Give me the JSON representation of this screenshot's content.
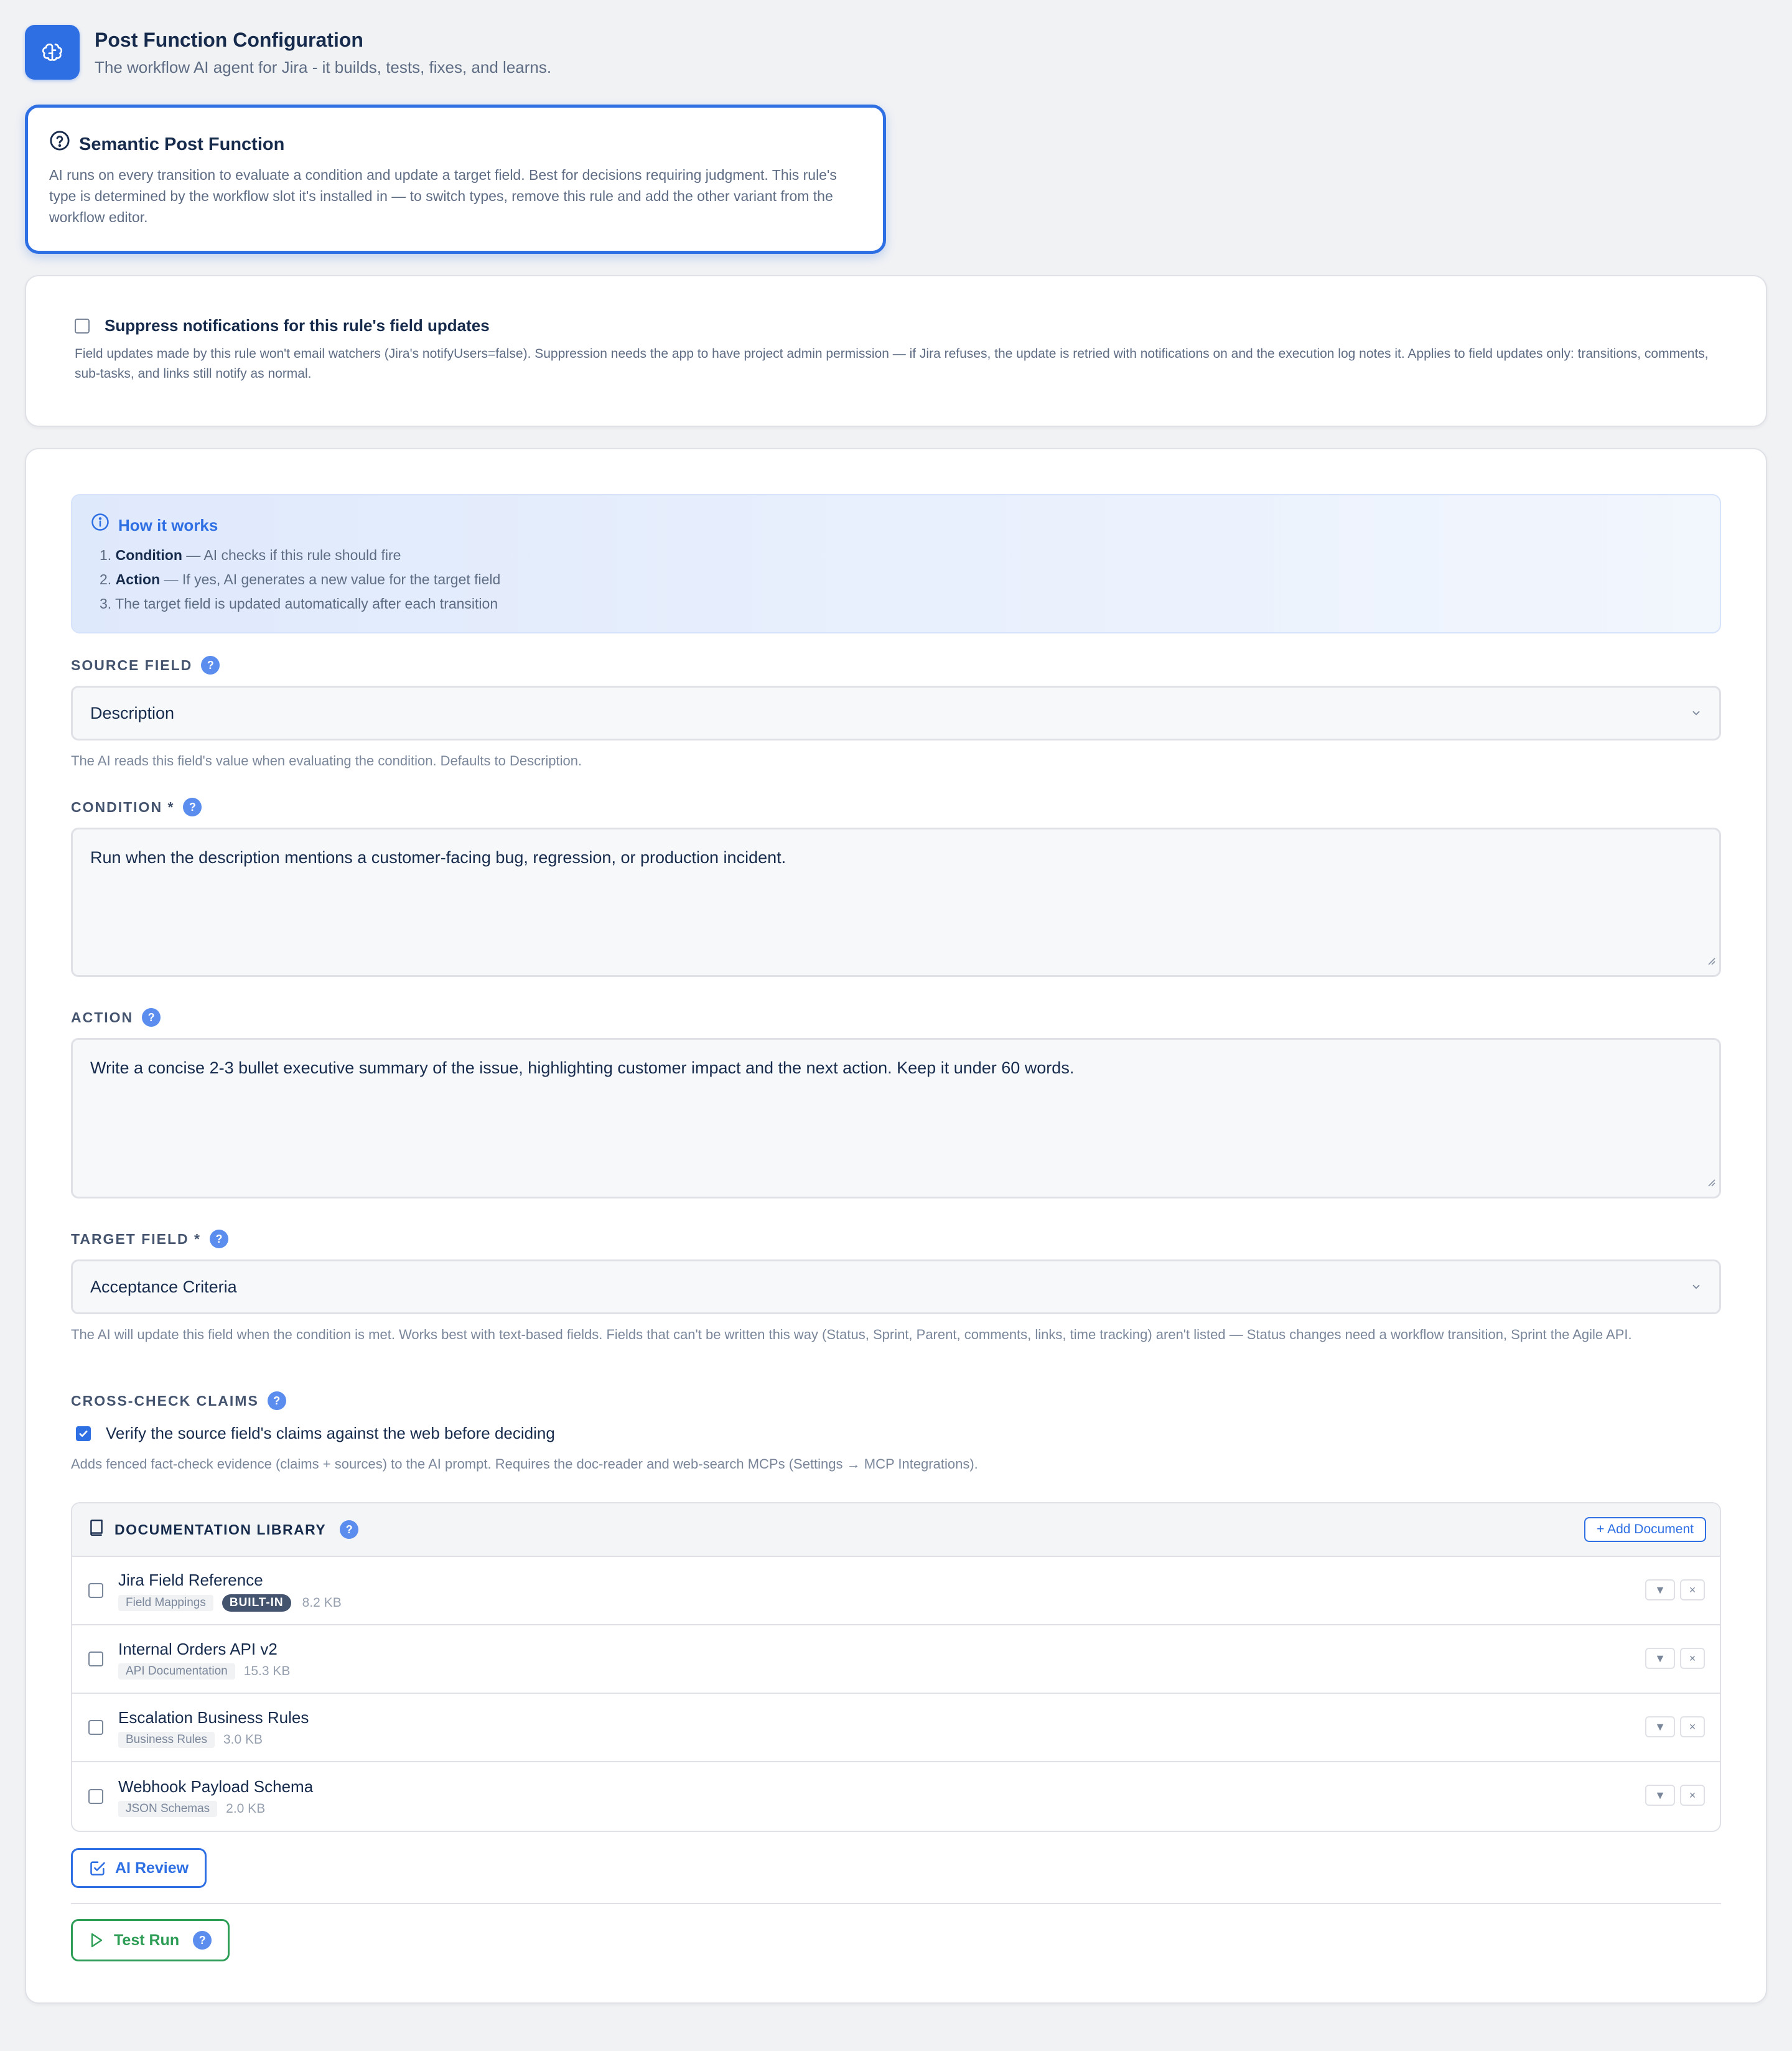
{
  "header": {
    "title": "Post Function Configuration",
    "subtitle": "The workflow AI agent for Jira - it builds, tests, fixes, and learns.",
    "logo_icon": "brain-icon"
  },
  "type_card": {
    "title": "Semantic Post Function",
    "description": "AI runs on every transition to evaluate a condition and update a target field. Best for decisions requiring judgment. This rule's type is determined by the workflow slot it's installed in — to switch types, remove this rule and add the other variant from the workflow editor."
  },
  "notifications": {
    "label": "Suppress notifications for this rule's field updates",
    "checked": false,
    "description": "Field updates made by this rule won't email watchers (Jira's notifyUsers=false). Suppression needs the app to have project admin permission — if Jira refuses, the update is retried with notifications on and the execution log notes it. Applies to field updates only: transitions, comments, sub-tasks, and links still notify as normal."
  },
  "how_it_works": {
    "title": "How it works",
    "steps": [
      {
        "num": "1.",
        "bold": "Condition",
        "text": " — AI checks if this rule should fire"
      },
      {
        "num": "2.",
        "bold": "Action",
        "text": " — If yes, AI generates a new value for the target field"
      },
      {
        "num": "3.",
        "bold": "",
        "text": "The target field is updated automatically after each transition"
      }
    ]
  },
  "source_field": {
    "label": "SOURCE FIELD",
    "value": "Description",
    "hint": "The AI reads this field's value when evaluating the condition. Defaults to Description."
  },
  "condition": {
    "label": "CONDITION *",
    "value": "Run when the description mentions a customer-facing bug, regression, or production incident."
  },
  "action": {
    "label": "ACTION",
    "value": "Write a concise 2-3 bullet executive summary of the issue, highlighting customer impact and the next action. Keep it under 60 words."
  },
  "target_field": {
    "label": "TARGET FIELD *",
    "value": "Acceptance Criteria",
    "hint": "The AI will update this field when the condition is met. Works best with text-based fields. Fields that can't be written this way (Status, Sprint, Parent, comments, links, time tracking) aren't listed — Status changes need a workflow transition, Sprint the Agile API."
  },
  "cross_check": {
    "label": "CROSS-CHECK CLAIMS",
    "checkbox_label": "Verify the source field's claims against the web before deciding",
    "checked": true,
    "hint": "Adds fenced fact-check evidence (claims + sources) to the AI prompt. Requires the doc-reader and web-search MCPs (Settings → MCP Integrations)."
  },
  "doc_library": {
    "title": "DOCUMENTATION LIBRARY",
    "add_label": "+ Add Document",
    "docs": [
      {
        "name": "Jira Field Reference",
        "tag": "Field Mappings",
        "badge": "BUILT-IN",
        "size": "8.2 KB"
      },
      {
        "name": "Internal Orders API v2",
        "tag": "API Documentation",
        "badge": "",
        "size": "15.3 KB"
      },
      {
        "name": "Escalation Business Rules",
        "tag": "Business Rules",
        "badge": "",
        "size": "3.0 KB"
      },
      {
        "name": "Webhook Payload Schema",
        "tag": "JSON Schemas",
        "badge": "",
        "size": "2.0 KB"
      }
    ],
    "expand_glyph": "▼",
    "remove_glyph": "×"
  },
  "buttons": {
    "ai_review": "AI Review",
    "test_run": "Test Run",
    "help_glyph": "?"
  },
  "colors": {
    "accent": "#2f6fe4",
    "success": "#2e9e57",
    "help": "#5a8dee"
  }
}
